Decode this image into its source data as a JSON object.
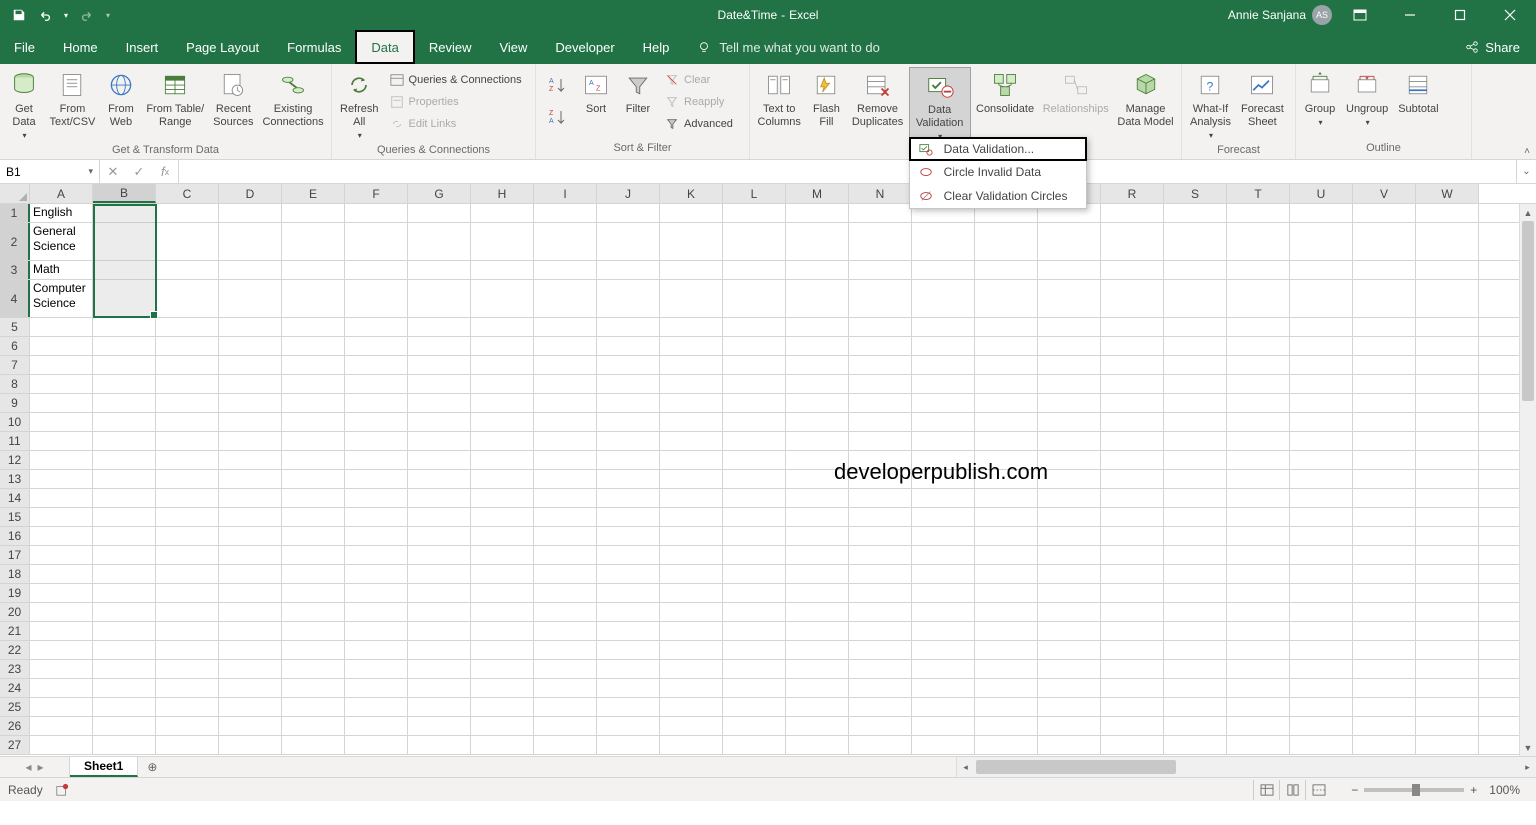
{
  "title": {
    "doc": "Date&Time",
    "app": "Excel"
  },
  "user": {
    "name": "Annie Sanjana",
    "initials": "AS"
  },
  "qat": {
    "save": "save",
    "undo": "undo",
    "redo": "redo"
  },
  "tabs": [
    "File",
    "Home",
    "Insert",
    "Page Layout",
    "Formulas",
    "Data",
    "Review",
    "View",
    "Developer",
    "Help"
  ],
  "active_tab": "Data",
  "tellme": "Tell me what you want to do",
  "share": "Share",
  "ribbon": {
    "groups": {
      "get_transform": {
        "label": "Get & Transform Data",
        "get_data": "Get\nData",
        "from_textcsv": "From\nText/CSV",
        "from_web": "From\nWeb",
        "from_table": "From Table/\nRange",
        "recent": "Recent\nSources",
        "existing": "Existing\nConnections"
      },
      "queries": {
        "label": "Queries & Connections",
        "refresh": "Refresh\nAll",
        "qc": "Queries & Connections",
        "props": "Properties",
        "edit_links": "Edit Links"
      },
      "sort_filter": {
        "label": "Sort & Filter",
        "sort": "Sort",
        "filter": "Filter",
        "clear": "Clear",
        "reapply": "Reapply",
        "advanced": "Advanced"
      },
      "data_tools": {
        "text_to_cols": "Text to\nColumns",
        "flash_fill": "Flash\nFill",
        "remove_dup": "Remove\nDuplicates",
        "data_validation": "Data\nValidation",
        "consolidate": "Consolidate",
        "relationships": "Relationships",
        "manage_dm": "Manage\nData Model"
      },
      "forecast": {
        "label": "Forecast",
        "whatif": "What-If\nAnalysis",
        "forecast_sheet": "Forecast\nSheet"
      },
      "outline": {
        "label": "Outline",
        "group": "Group",
        "ungroup": "Ungroup",
        "subtotal": "Subtotal"
      }
    },
    "dv_menu": {
      "validation": "Data Validation...",
      "circle": "Circle Invalid Data",
      "clear": "Clear Validation Circles"
    }
  },
  "namebox": "B1",
  "columns": [
    "A",
    "B",
    "C",
    "D",
    "E",
    "F",
    "G",
    "H",
    "I",
    "J",
    "K",
    "L",
    "M",
    "N",
    "O",
    "P",
    "Q",
    "R",
    "S",
    "T",
    "U",
    "V",
    "W"
  ],
  "cells": {
    "A1": "English",
    "A2": "General Science",
    "A3": "Math",
    "A4": "Computer Science"
  },
  "row_heights": {
    "2": "tall",
    "4": "tall"
  },
  "selection": {
    "ref": "B1:B4"
  },
  "watermark": "developerpublish.com",
  "sheet": {
    "active": "Sheet1"
  },
  "status": {
    "ready": "Ready",
    "zoom": "100%"
  }
}
